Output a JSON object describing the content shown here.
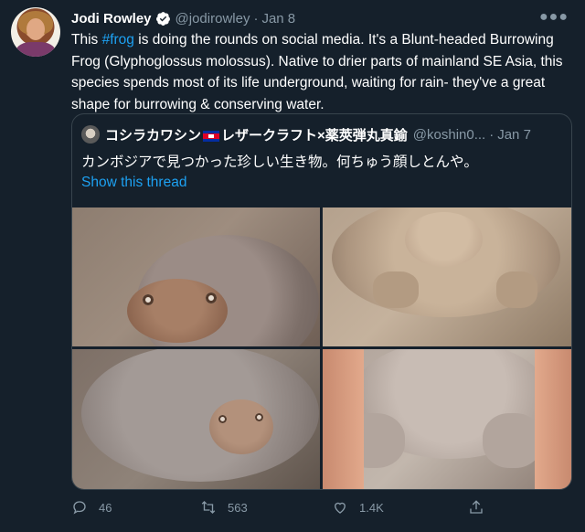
{
  "tweet": {
    "author": {
      "name": "Jodi Rowley",
      "handle": "@jodirowley",
      "verified": true
    },
    "date": "Jan 8",
    "text_before": "This ",
    "hashtag": "#frog",
    "text_after": " is doing the rounds on social media. It's a Blunt-headed Burrowing Frog (Glyphoglossus molossus). Native to drier parts of mainland SE Asia, this species spends most of its life underground, waiting for rain- they've a great shape for burrowing & conserving water.",
    "more_icon": "ellipsis-icon"
  },
  "quote": {
    "author_name_part1": "コシラカワシン",
    "author_name_part2": "レザークラフト×薬莢弾丸真鍮",
    "flag_icon": "cambodia-flag-icon",
    "handle": "@koshin0...",
    "date": "Jan 7",
    "text": "カンボジアで見つかった珍しい生き物。何ちゅう顔しとんや。",
    "show_thread": "Show this thread",
    "images": [
      "frog-photo-1",
      "frog-photo-2",
      "frog-photo-3",
      "frog-photo-4"
    ]
  },
  "actions": {
    "reply_count": "46",
    "retweet_count": "563",
    "like_count": "1.4K"
  },
  "colors": {
    "background": "#15202b",
    "accent": "#1da1f2",
    "muted": "#8899a6",
    "border": "#38444d"
  }
}
